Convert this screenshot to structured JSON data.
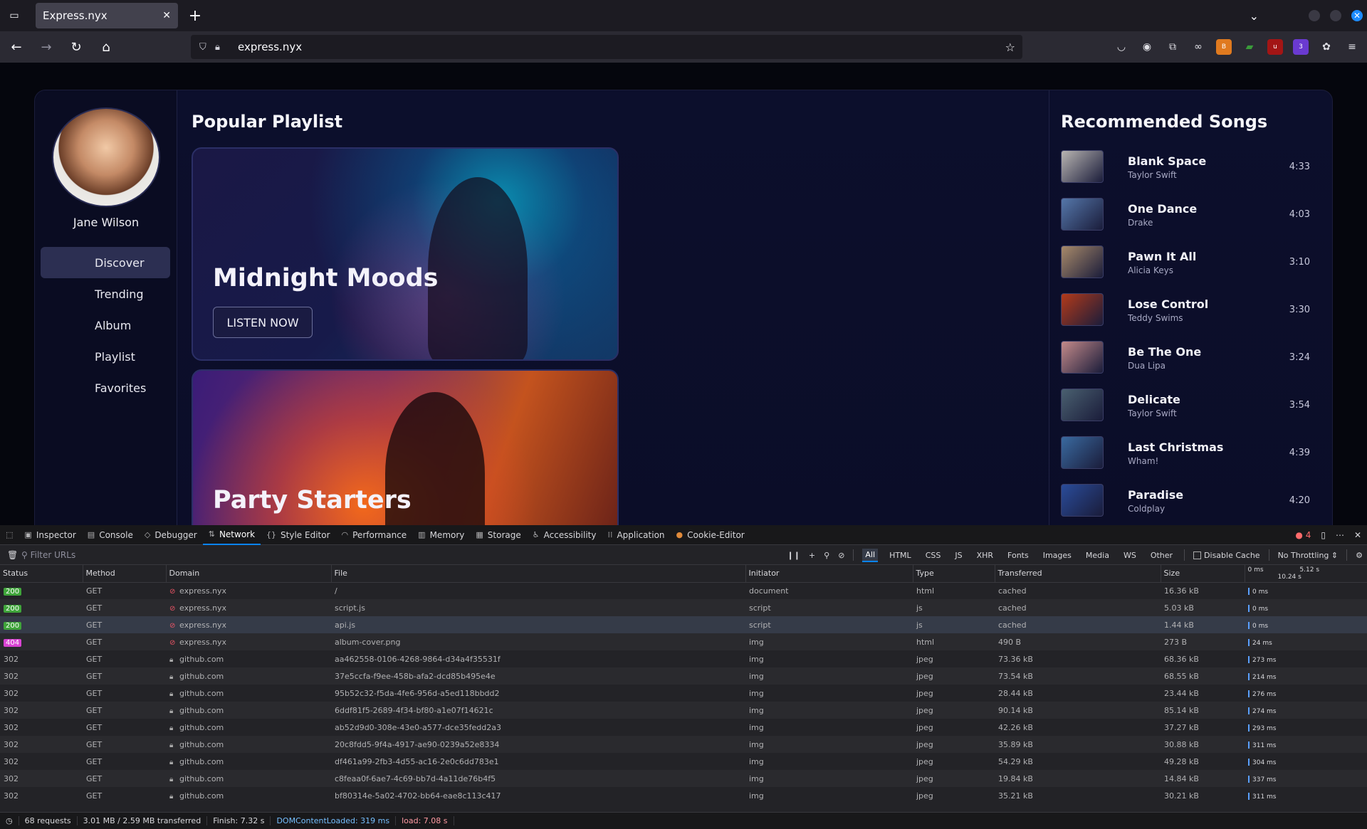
{
  "browser": {
    "tab_title": "Express.nyx",
    "url": "express.nyx"
  },
  "sidebar": {
    "user_name": "Jane Wilson",
    "items": [
      {
        "label": "Discover",
        "active": true
      },
      {
        "label": "Trending"
      },
      {
        "label": "Album"
      },
      {
        "label": "Playlist"
      },
      {
        "label": "Favorites"
      }
    ]
  },
  "main": {
    "title": "Popular Playlist",
    "playlists": [
      {
        "title": "Midnight Moods",
        "button": "LISTEN NOW"
      },
      {
        "title": "Party Starters"
      }
    ]
  },
  "recommended": {
    "title": "Recommended Songs",
    "songs": [
      {
        "title": "Blank Space",
        "artist": "Taylor Swift",
        "duration": "4:33",
        "color": "#b9b5b2"
      },
      {
        "title": "One Dance",
        "artist": "Drake",
        "duration": "4:03",
        "color": "#5577aa"
      },
      {
        "title": "Pawn It All",
        "artist": "Alicia Keys",
        "duration": "3:10",
        "color": "#a88a6a"
      },
      {
        "title": "Lose Control",
        "artist": "Teddy Swims",
        "duration": "3:30",
        "color": "#b33a1a"
      },
      {
        "title": "Be The One",
        "artist": "Dua Lipa",
        "duration": "3:24",
        "color": "#c48a8a"
      },
      {
        "title": "Delicate",
        "artist": "Taylor Swift",
        "duration": "3:54",
        "color": "#4a6070"
      },
      {
        "title": "Last Christmas",
        "artist": "Wham!",
        "duration": "4:39",
        "color": "#3a6aa0"
      },
      {
        "title": "Paradise",
        "artist": "Coldplay",
        "duration": "4:20",
        "color": "#2a4c9a"
      }
    ]
  },
  "devtools": {
    "tabs": [
      "Inspector",
      "Console",
      "Debugger",
      "Network",
      "Style Editor",
      "Performance",
      "Memory",
      "Storage",
      "Accessibility",
      "Application",
      "Cookie-Editor"
    ],
    "active_tab": "Network",
    "error_count": "4",
    "filter_placeholder": "Filter URLs",
    "filter_types": [
      "All",
      "HTML",
      "CSS",
      "JS",
      "XHR",
      "Fonts",
      "Images",
      "Media",
      "WS",
      "Other"
    ],
    "disable_cache": "Disable Cache",
    "throttling": "No Throttling ⇕",
    "columns": [
      "Status",
      "Method",
      "Domain",
      "File",
      "Initiator",
      "Type",
      "Transferred",
      "Size"
    ],
    "waterfall_ticks": [
      "0 ms",
      "5.12 s",
      "10.24 s"
    ],
    "rows": [
      {
        "status": "200",
        "method": "GET",
        "domain": "express.nyx",
        "file": "/",
        "initiator": "document",
        "type": "html",
        "transferred": "cached",
        "size": "16.36 kB",
        "timing": "0 ms"
      },
      {
        "status": "200",
        "method": "GET",
        "domain": "express.nyx",
        "file": "script.js",
        "initiator": "script",
        "type": "js",
        "transferred": "cached",
        "size": "5.03 kB",
        "timing": "0 ms"
      },
      {
        "status": "200",
        "method": "GET",
        "domain": "express.nyx",
        "file": "api.js",
        "initiator": "script",
        "type": "js",
        "transferred": "cached",
        "size": "1.44 kB",
        "timing": "0 ms"
      },
      {
        "status": "404",
        "method": "GET",
        "domain": "express.nyx",
        "file": "album-cover.png",
        "initiator": "img",
        "type": "html",
        "transferred": "490 B",
        "size": "273 B",
        "timing": "24 ms"
      },
      {
        "status": "302",
        "method": "GET",
        "domain": "github.com",
        "file": "aa462558-0106-4268-9864-d34a4f35531f",
        "initiator": "img",
        "type": "jpeg",
        "transferred": "73.36 kB",
        "size": "68.36 kB",
        "timing": "273 ms"
      },
      {
        "status": "302",
        "method": "GET",
        "domain": "github.com",
        "file": "37e5ccfa-f9ee-458b-afa2-dcd85b495e4e",
        "initiator": "img",
        "type": "jpeg",
        "transferred": "73.54 kB",
        "size": "68.55 kB",
        "timing": "214 ms"
      },
      {
        "status": "302",
        "method": "GET",
        "domain": "github.com",
        "file": "95b52c32-f5da-4fe6-956d-a5ed118bbdd2",
        "initiator": "img",
        "type": "jpeg",
        "transferred": "28.44 kB",
        "size": "23.44 kB",
        "timing": "276 ms"
      },
      {
        "status": "302",
        "method": "GET",
        "domain": "github.com",
        "file": "6ddf81f5-2689-4f34-bf80-a1e07f14621c",
        "initiator": "img",
        "type": "jpeg",
        "transferred": "90.14 kB",
        "size": "85.14 kB",
        "timing": "274 ms"
      },
      {
        "status": "302",
        "method": "GET",
        "domain": "github.com",
        "file": "ab52d9d0-308e-43e0-a577-dce35fedd2a3",
        "initiator": "img",
        "type": "jpeg",
        "transferred": "42.26 kB",
        "size": "37.27 kB",
        "timing": "293 ms"
      },
      {
        "status": "302",
        "method": "GET",
        "domain": "github.com",
        "file": "20c8fdd5-9f4a-4917-ae90-0239a52e8334",
        "initiator": "img",
        "type": "jpeg",
        "transferred": "35.89 kB",
        "size": "30.88 kB",
        "timing": "311 ms"
      },
      {
        "status": "302",
        "method": "GET",
        "domain": "github.com",
        "file": "df461a99-2fb3-4d55-ac16-2e0c6dd783e1",
        "initiator": "img",
        "type": "jpeg",
        "transferred": "54.29 kB",
        "size": "49.28 kB",
        "timing": "304 ms"
      },
      {
        "status": "302",
        "method": "GET",
        "domain": "github.com",
        "file": "c8feaa0f-6ae7-4c69-bb7d-4a11de76b4f5",
        "initiator": "img",
        "type": "jpeg",
        "transferred": "19.84 kB",
        "size": "14.84 kB",
        "timing": "337 ms"
      },
      {
        "status": "302",
        "method": "GET",
        "domain": "github.com",
        "file": "bf80314e-5a02-4702-bb64-eae8c113c417",
        "initiator": "img",
        "type": "jpeg",
        "transferred": "35.21 kB",
        "size": "30.21 kB",
        "timing": "311 ms"
      }
    ],
    "statusbar": {
      "requests": "68 requests",
      "transferred": "3.01 MB / 2.59 MB transferred",
      "finish": "Finish: 7.32 s",
      "dcl": "DOMContentLoaded: 319 ms",
      "load": "load: 7.08 s"
    }
  }
}
